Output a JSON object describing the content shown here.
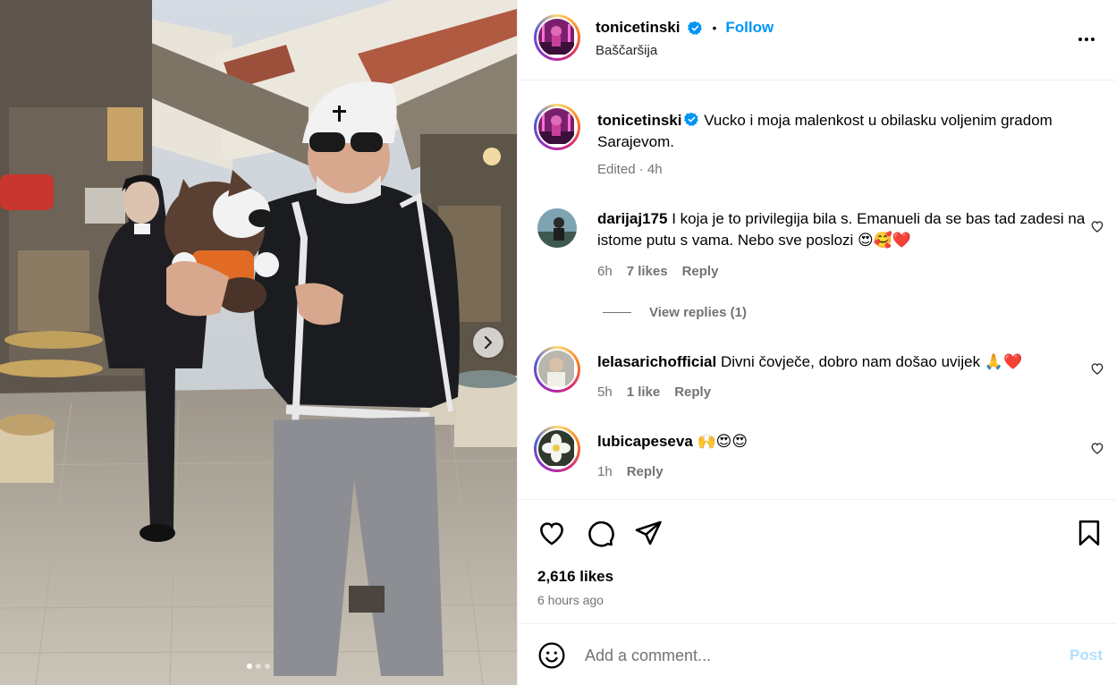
{
  "post": {
    "username": "tonicetinski",
    "verified": true,
    "follow_label": "Follow",
    "separator": "•",
    "location": "Baščaršija",
    "caption": "Vucko i moja malenkost u obilasku voljenim gradom Sarajevom.",
    "caption_meta": "Edited · 4h"
  },
  "comments": [
    {
      "username": "darijaj175",
      "text": "I koja je to privilegija bila s. Emanueli da se bas tad zadesi na istome putu s vama. Nebo sve poslozi 😍🥰❤️",
      "age": "6h",
      "likes": "7 likes",
      "reply": "Reply",
      "view_replies": "View replies (1)"
    },
    {
      "username": "lelasarichofficial",
      "text": "Divni čovječe, dobro nam došao uvijek 🙏❤️",
      "age": "5h",
      "likes": "1 like",
      "reply": "Reply"
    },
    {
      "username": "lubicapeseva",
      "text": "🙌😍😍",
      "age": "1h",
      "reply": "Reply"
    }
  ],
  "stats": {
    "likes": "2,616 likes",
    "time_ago": "6 hours ago"
  },
  "composer": {
    "placeholder": "Add a comment...",
    "post_label": "Post"
  },
  "carousel": {
    "slide_count": 3,
    "active_slide": 1
  },
  "icons": [
    "more-icon",
    "verified-badge-icon",
    "heart-icon",
    "comment-icon",
    "share-icon",
    "bookmark-icon",
    "emoji-icon",
    "chevron-right-icon"
  ],
  "colors": {
    "link_blue": "#0095f6",
    "post_disabled": "#b2dffc",
    "muted_text": "#737373",
    "divider": "#efefef",
    "heart_red": "#ff3040"
  }
}
